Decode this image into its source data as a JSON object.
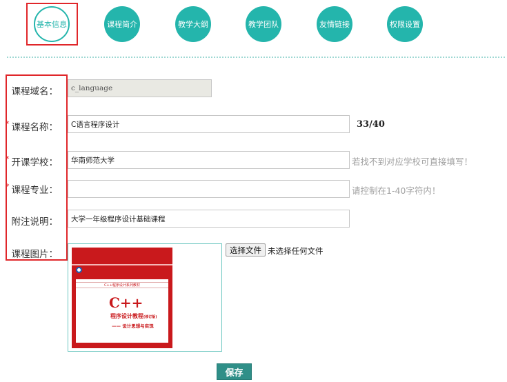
{
  "tabs": [
    {
      "label": "基本信息",
      "active": true
    },
    {
      "label": "课程简介",
      "active": false
    },
    {
      "label": "教学大纲",
      "active": false
    },
    {
      "label": "教学团队",
      "active": false
    },
    {
      "label": "友情链接",
      "active": false
    },
    {
      "label": "权限设置",
      "active": false
    }
  ],
  "colors": {
    "accent": "#24b5ac",
    "highlight": "#e0262a",
    "save_button": "#2f8f88"
  },
  "form": {
    "domain": {
      "label": "课程域名：",
      "value": "c_language",
      "disabled": true
    },
    "name": {
      "label": "课程名称：",
      "required_mark": "*",
      "value": "C语言程序设计",
      "counter": "33/40"
    },
    "school": {
      "label": "开课学校：",
      "required_mark": "*",
      "value": "华南师范大学",
      "hint": "若找不到对应学校可直接填写！"
    },
    "major": {
      "label": "课程专业：",
      "required_mark": "*",
      "value": "",
      "hint": "请控制在1-40字符内！"
    },
    "note": {
      "label": "附注说明：",
      "value": "大学一年级程序设计基础课程"
    },
    "image": {
      "label": "课程图片：",
      "choose_button": "选择文件",
      "file_status": "未选择任何文件",
      "cover": {
        "series": "C++程序设计系列教材",
        "title": "C++",
        "subtitle": "程序设计教程",
        "edition": "(修订版)",
        "tagline": "—— 设计思想与实现"
      }
    }
  },
  "save_button": "保存"
}
